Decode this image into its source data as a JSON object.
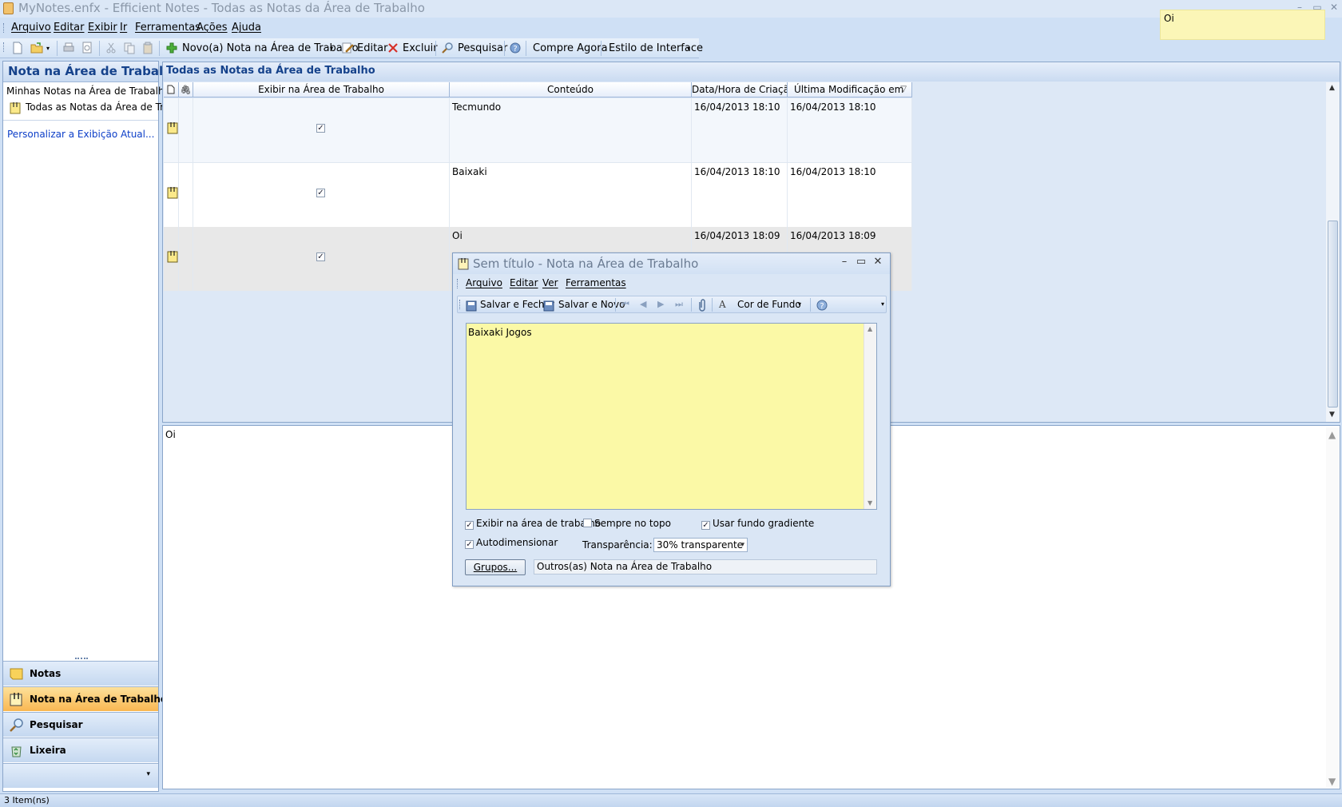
{
  "window": {
    "title": "MyNotes.enfx - Efficient Notes - Todas as Notas da Área de Trabalho",
    "minimize": "–",
    "maximize": "▭",
    "close": "✕"
  },
  "desktop_note": {
    "text": "Oi"
  },
  "menubar": {
    "items": [
      "Arquivo",
      "Editar",
      "Exibir",
      "Ir",
      "Ferramentas",
      "Ações",
      "Ajuda"
    ]
  },
  "toolbar": {
    "new_label": "Novo(a) Nota na Área de Trabalho",
    "edit_label": "Editar",
    "delete_label": "Excluir",
    "search_label": "Pesquisar",
    "buy_label": "Compre Agora",
    "style_label": "Estilo de Interface"
  },
  "left_pane": {
    "title": "Nota na Área de Trabalho",
    "tree_root": "Minhas Notas na Área de Trabalho",
    "tree_selected": "Todas as Notas da Área de Trab",
    "customize_link": "Personalizar a Exibição Atual...",
    "nav_buttons": [
      {
        "label": "Notas",
        "icon": "notes-icon",
        "active": false
      },
      {
        "label": "Nota na Área de Trabalho",
        "icon": "desktop-note-icon",
        "active": true
      },
      {
        "label": "Pesquisar",
        "icon": "search-icon",
        "active": false
      },
      {
        "label": "Lixeira",
        "icon": "recycle-bin-icon",
        "active": false
      }
    ],
    "more_arrow": "▾"
  },
  "grid": {
    "title": "Todas as Notas da Área de Trabalho",
    "columns": {
      "show_on_desktop": "Exibir na Área de Trabalho",
      "content": "Conteúdo",
      "created": "Data/Hora de Criação",
      "modified": "Última Modificação em"
    },
    "rows": [
      {
        "content": "Tecmundo",
        "created": "16/04/2013 18:10",
        "modified": "16/04/2013 18:10",
        "shown": true
      },
      {
        "content": "Baixaki",
        "created": "16/04/2013 18:10",
        "modified": "16/04/2013 18:10",
        "shown": true
      },
      {
        "content": "Oi",
        "created": "16/04/2013 18:09",
        "modified": "16/04/2013 18:09",
        "shown": true
      }
    ]
  },
  "preview": {
    "text": "Oi"
  },
  "status": {
    "text": "3 Item(ns)"
  },
  "dialog": {
    "title": "Sem título - Nota na Área de Trabalho",
    "menu": [
      "Arquivo",
      "Editar",
      "Ver",
      "Ferramentas"
    ],
    "toolbar": {
      "save_close": "Salvar e Fechar",
      "save_new": "Salvar e Novo",
      "font_letter": "A",
      "bg_color": "Cor de Fundo"
    },
    "editor_text": "Baixaki Jogos",
    "options": {
      "show_on_desktop": "Exibir na área de trabalho",
      "always_on_top": "Sempre no topo",
      "gradient_bg": "Usar fundo gradiente",
      "auto_size": "Autodimensionar",
      "transparency_label": "Transparência:",
      "transparency_value": "30% transparente"
    },
    "groups_button": "Grupos...",
    "groups_value": "Outros(as) Nota na Área de Trabalho"
  },
  "colors": {
    "accent_header": "#15428b",
    "note_yellow": "#fbf9a6",
    "active_nav": "#f9b752",
    "link": "#0c3ec8"
  }
}
